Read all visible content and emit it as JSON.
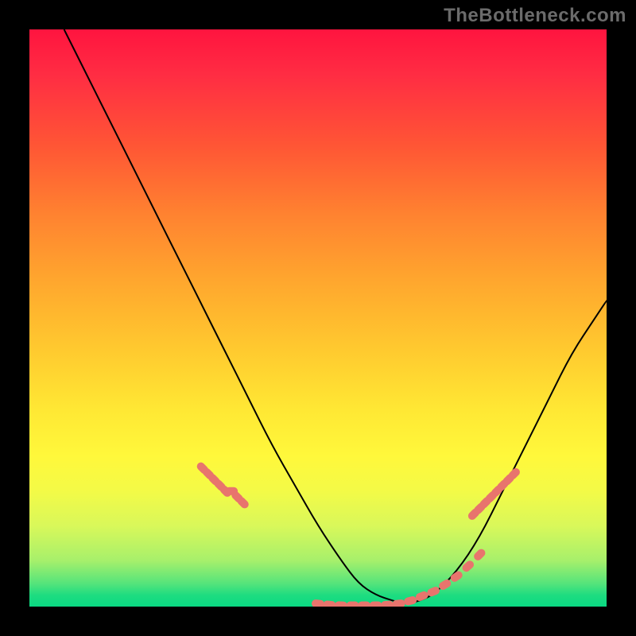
{
  "watermark": "TheBottleneck.com",
  "chart_data": {
    "type": "line",
    "title": "",
    "xlabel": "",
    "ylabel": "",
    "xlim": [
      0,
      100
    ],
    "ylim": [
      0,
      100
    ],
    "grid": false,
    "legend": false,
    "background": "gradient red-yellow-green vertical",
    "series": [
      {
        "name": "bottleneck-curve",
        "color": "#000000",
        "x": [
          6,
          10,
          14,
          18,
          22,
          26,
          30,
          34,
          38,
          42,
          46,
          50,
          54,
          57,
          60,
          63,
          65,
          67,
          70,
          74,
          78,
          82,
          86,
          90,
          94,
          98,
          100
        ],
        "y": [
          100,
          92,
          84,
          76,
          68,
          60,
          52,
          44,
          36,
          28,
          21,
          14,
          8,
          4,
          2,
          1,
          0.5,
          0.8,
          2,
          6,
          12,
          20,
          28,
          36,
          44,
          50,
          53
        ]
      },
      {
        "name": "highlight-dots-left",
        "type": "scatter",
        "color": "#e8746d",
        "x": [
          30,
          31,
          32,
          33,
          34,
          35,
          36,
          37
        ],
        "y": [
          24,
          23,
          22,
          21,
          20,
          20,
          19,
          18
        ]
      },
      {
        "name": "highlight-dots-bottom",
        "type": "scatter",
        "color": "#e8746d",
        "x": [
          50,
          52,
          54,
          56,
          58,
          60,
          62,
          64,
          66,
          68,
          70,
          72,
          74,
          76,
          78
        ],
        "y": [
          0.5,
          0.3,
          0.2,
          0.2,
          0.2,
          0.2,
          0.3,
          0.5,
          1.0,
          1.8,
          2.6,
          3.8,
          5.2,
          7.0,
          9.0
        ]
      },
      {
        "name": "highlight-dots-right",
        "type": "scatter",
        "color": "#e8746d",
        "x": [
          77,
          78,
          79,
          80,
          81,
          82,
          83,
          84
        ],
        "y": [
          16,
          17,
          18,
          19,
          20,
          21,
          22,
          23
        ]
      }
    ]
  }
}
